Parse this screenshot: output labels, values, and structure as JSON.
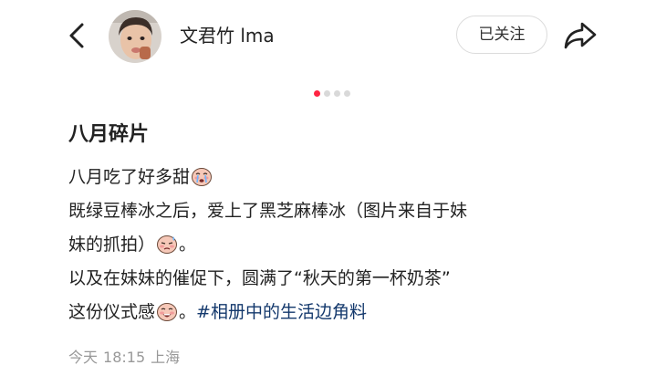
{
  "header": {
    "author_name": "文君竹 lma",
    "follow_label": "已关注"
  },
  "carousel": {
    "total": 4,
    "active_index": 0
  },
  "note": {
    "title": "八月碎片",
    "lines": {
      "l1": "八月吃了好多甜",
      "l2": "既绿豆棒冰之后，爱上了黑芝麻棒冰（图片来自于妹",
      "l3a": "妹的抓拍）",
      "l3b": "。",
      "l4": "以及在妹妹的催促下，圆满了“秋天的第一杯奶茶”",
      "l5a": "这份仪式感",
      "l5b": "。",
      "hashtag": "#相册中的生活边角料"
    },
    "meta": {
      "date": "今天",
      "time": "18:15",
      "location": "上海"
    }
  },
  "colors": {
    "accent": "#ff2442",
    "hashtag": "#13386c",
    "meta": "#999999"
  }
}
